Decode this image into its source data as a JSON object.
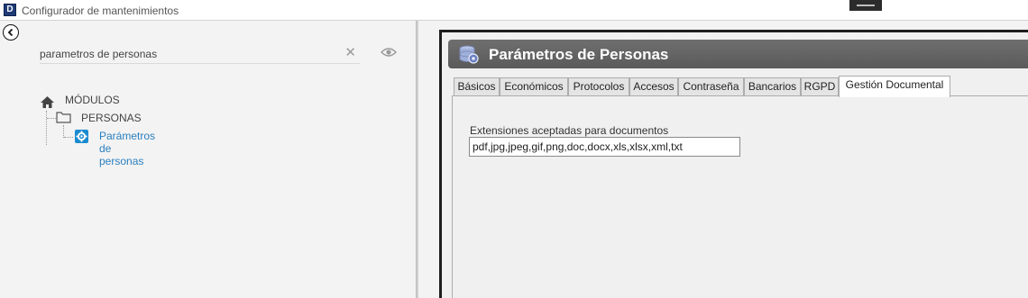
{
  "window": {
    "logo_letter": "D",
    "title": "Configurador de mantenimientos"
  },
  "left": {
    "search": {
      "value": "parametros de personas",
      "placeholder": ""
    },
    "icons": [
      "back-arrow-icon",
      "clear-icon",
      "eye-icon",
      "home-icon",
      "folder-icon",
      "gear-icon"
    ],
    "tree": {
      "root_label": "MÓDULOS",
      "folder_label": "PERSONAS",
      "item_label": "Parámetros de personas"
    }
  },
  "dialog": {
    "title": "Parámetros de Personas",
    "tabs": [
      {
        "label": "Básicos",
        "active": false
      },
      {
        "label": "Económicos",
        "active": false
      },
      {
        "label": "Protocolos",
        "active": false
      },
      {
        "label": "Accesos",
        "active": false
      },
      {
        "label": "Contraseña",
        "active": false
      },
      {
        "label": "Bancarios",
        "active": false
      },
      {
        "label": "RGPD",
        "active": false
      },
      {
        "label": "Gestión Documental",
        "active": true
      }
    ],
    "field": {
      "label": "Extensiones aceptadas para documentos",
      "value": "pdf,jpg,jpeg,gif,png,doc,docx,xls,xlsx,xml,txt"
    }
  },
  "colors": {
    "accent_blue": "#1a8bd1",
    "link_blue": "#2a7fbf",
    "header_gray": "#666666"
  }
}
